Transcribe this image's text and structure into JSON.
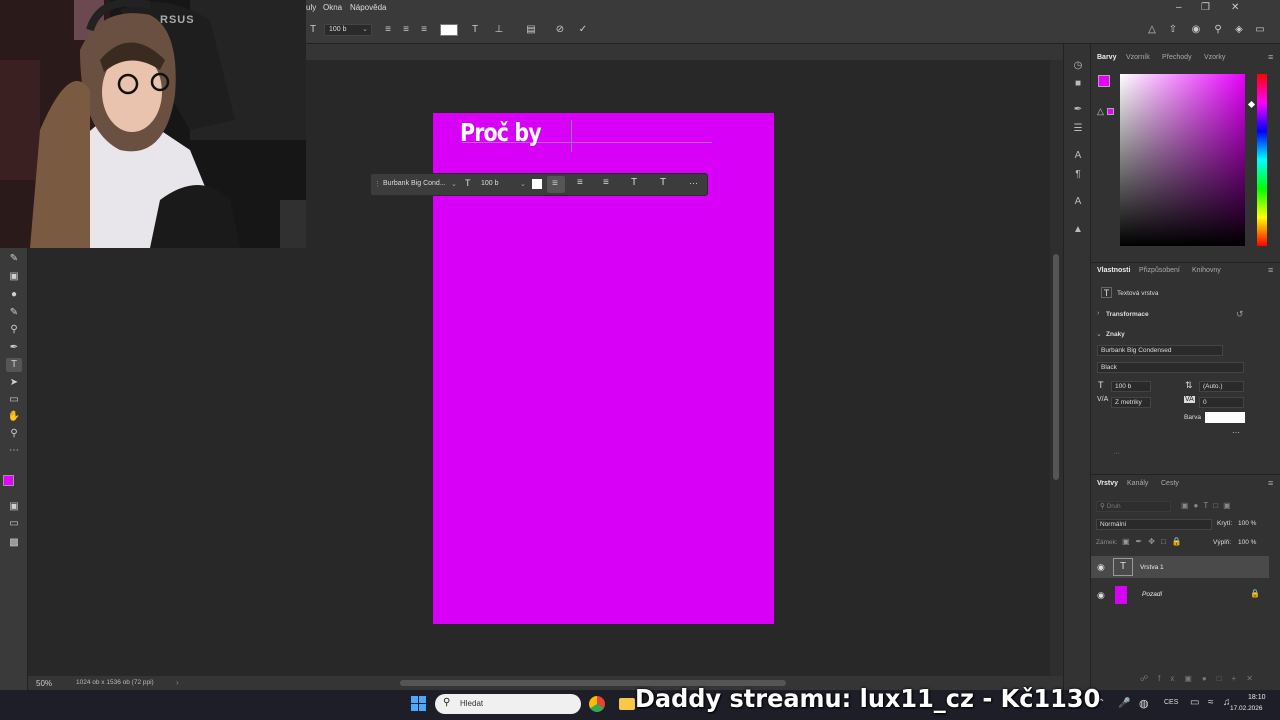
{
  "menu": {
    "items": [
      "uly",
      "Okna",
      "Nápověda"
    ]
  },
  "options_bar": {
    "font_size": "100 b"
  },
  "document": {
    "text": "Proč by",
    "page_color": "#d800f7"
  },
  "context_bar": {
    "font": "Burbank Big Cond...",
    "size": "100 b",
    "more": "···"
  },
  "status": {
    "zoom": "50%",
    "doc_info": "1024 ob x 1536 ob (72 ppi)"
  },
  "color_panel": {
    "tabs": [
      "Barvy",
      "Vzorník",
      "Přechody",
      "Vzorky"
    ],
    "foreground": "#e700ff",
    "background": "#ffffff"
  },
  "properties": {
    "tabs": [
      "Vlastnosti",
      "Přizpůsobení",
      "Knihovny"
    ],
    "layer_type": "Textová vrstva",
    "transform_label": "Transformace",
    "chars_label": "Znaky",
    "font_family": "Burbank Big Condensed",
    "font_style": "Black",
    "size": "100 b",
    "leading": "(Auto.)",
    "kerning": "Z metriky",
    "tracking": "0",
    "color_label": "Barva",
    "more": "···",
    "collapse": "···"
  },
  "layers_panel": {
    "tabs": [
      "Vrstvy",
      "Kanály",
      "Cesty"
    ],
    "filter_placeholder": "Druh",
    "blend_mode": "Normální",
    "opacity_label": "Krytí:",
    "opacity": "100 %",
    "lock_label": "Zámek:",
    "fill_label": "Výplň:",
    "fill": "100 %",
    "layers": [
      {
        "name": "Vrstva 1"
      },
      {
        "name": "Pozadí"
      }
    ]
  },
  "taskbar": {
    "search_placeholder": "Hledat",
    "lang": "CES",
    "time": "18:10",
    "date": "17.02.2026"
  },
  "overlay_text": "Daddy streamu: lux11_cz - Kč1130",
  "webcam": {
    "chair_brand": "RSUS"
  }
}
